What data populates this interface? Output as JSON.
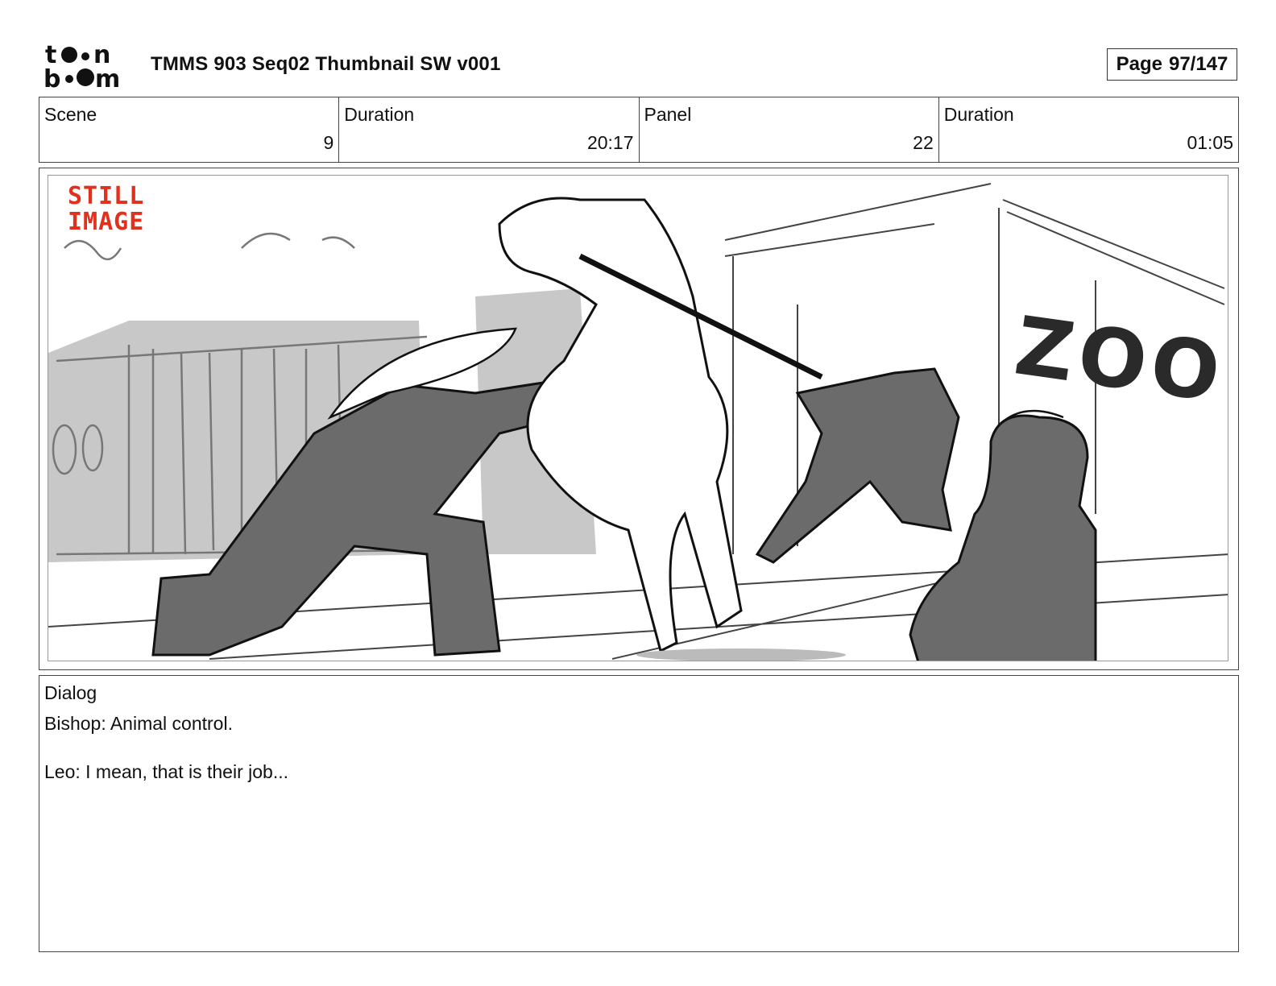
{
  "header": {
    "logo_top": "to•n",
    "logo_bottom": "b••m",
    "title": "TMMS 903 Seq02 Thumbnail SW v001",
    "page_label": "Page",
    "page_value": "97/147"
  },
  "info": [
    {
      "label": "Scene",
      "value": "9"
    },
    {
      "label": "Duration",
      "value": "20:17"
    },
    {
      "label": "Panel",
      "value": "22"
    },
    {
      "label": "Duration",
      "value": "01:05"
    }
  ],
  "panel": {
    "still_line1": "STILL",
    "still_line2": "IMAGE",
    "sign_text": "ZOO",
    "accent_color": "#e0301e"
  },
  "dialog": {
    "label": "Dialog",
    "lines": [
      "Bishop: Animal control.",
      "Leo: I mean, that is their job..."
    ]
  }
}
